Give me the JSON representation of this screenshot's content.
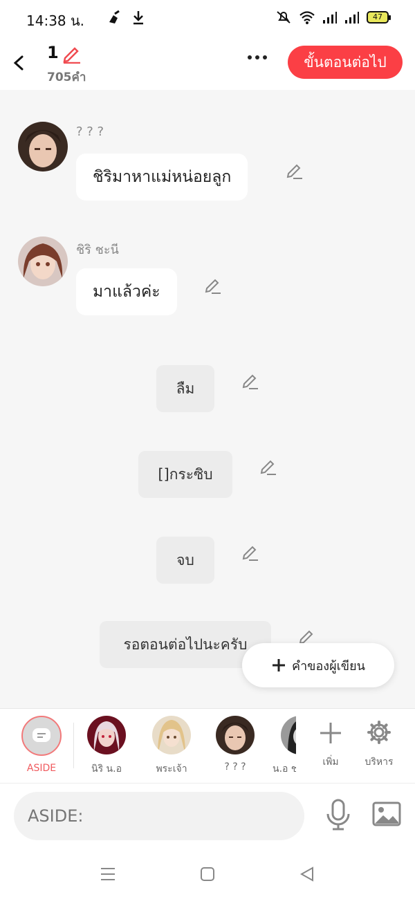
{
  "status_bar": {
    "time": "14:38 น.",
    "battery": "47"
  },
  "header": {
    "episode_number": "1",
    "word_count": "705คำ",
    "next_button": "ขั้นตอนต่อไป"
  },
  "messages": [
    {
      "speaker": "? ? ?",
      "text": "ชิริมาหาแม่หน่อยลูก"
    },
    {
      "speaker": "ชิริ ชะนี",
      "text": "มาแล้วค่ะ"
    }
  ],
  "narrations": [
    "ลืม",
    "[]กระซิบ",
    "จบ",
    "รอตอนต่อไปนะครับ"
  ],
  "fab": {
    "label": "คำของผู้เขียน"
  },
  "characters": [
    {
      "label": "ASIDE"
    },
    {
      "label": "นิริ น.อ"
    },
    {
      "label": "พระเจ้า"
    },
    {
      "label": "? ? ?"
    },
    {
      "label": "น.อ ช"
    }
  ],
  "tools": {
    "add_label": "เพิ่ม",
    "manage_label": "บริหาร"
  },
  "input": {
    "placeholder": "ASIDE:"
  },
  "colors": {
    "accent": "#fb3f45",
    "background": "#f6f6f6"
  }
}
